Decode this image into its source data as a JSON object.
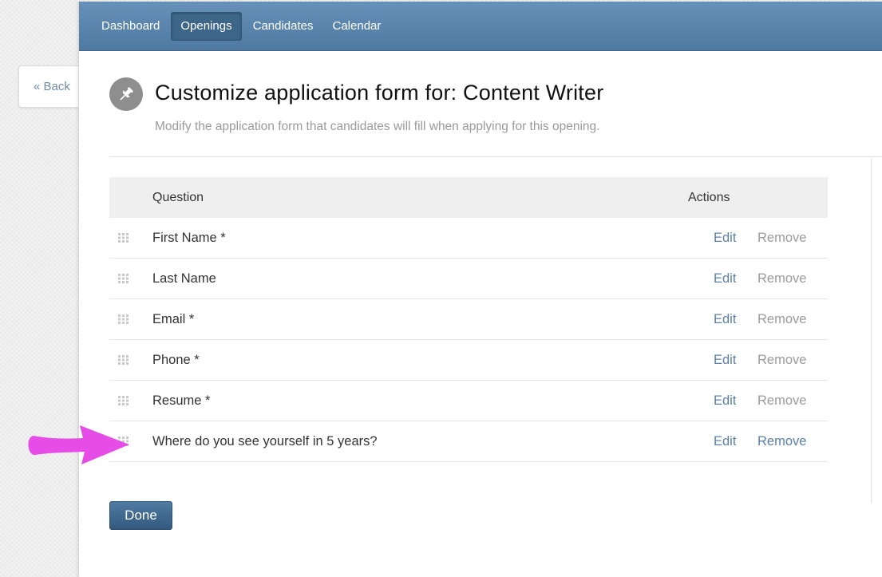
{
  "back": {
    "label": "« Back"
  },
  "nav": {
    "items": [
      {
        "label": "Dashboard",
        "active": false
      },
      {
        "label": "Openings",
        "active": true
      },
      {
        "label": "Candidates",
        "active": false
      },
      {
        "label": "Calendar",
        "active": false
      }
    ]
  },
  "header": {
    "icon": "pushpin-icon",
    "title": "Customize application form for: Content Writer",
    "subtitle": "Modify the application form that candidates will fill when applying for this opening."
  },
  "table": {
    "columns": {
      "question": "Question",
      "actions": "Actions"
    },
    "rows": [
      {
        "question": "First Name *",
        "edit": "Edit",
        "remove": "Remove"
      },
      {
        "question": "Last Name",
        "edit": "Edit",
        "remove": "Remove"
      },
      {
        "question": "Email *",
        "edit": "Edit",
        "remove": "Remove"
      },
      {
        "question": "Phone *",
        "edit": "Edit",
        "remove": "Remove"
      },
      {
        "question": "Resume *",
        "edit": "Edit",
        "remove": "Remove"
      },
      {
        "question": "Where do you see yourself in 5 years?",
        "edit": "Edit",
        "remove": "Remove"
      }
    ]
  },
  "done": {
    "label": "Done"
  },
  "colors": {
    "nav_top": "#6791b8",
    "nav_bottom": "#4e79a0",
    "link": "#5b7fa6",
    "muted_link": "#9b9b9b",
    "annotation_arrow": "#e64ce6"
  }
}
